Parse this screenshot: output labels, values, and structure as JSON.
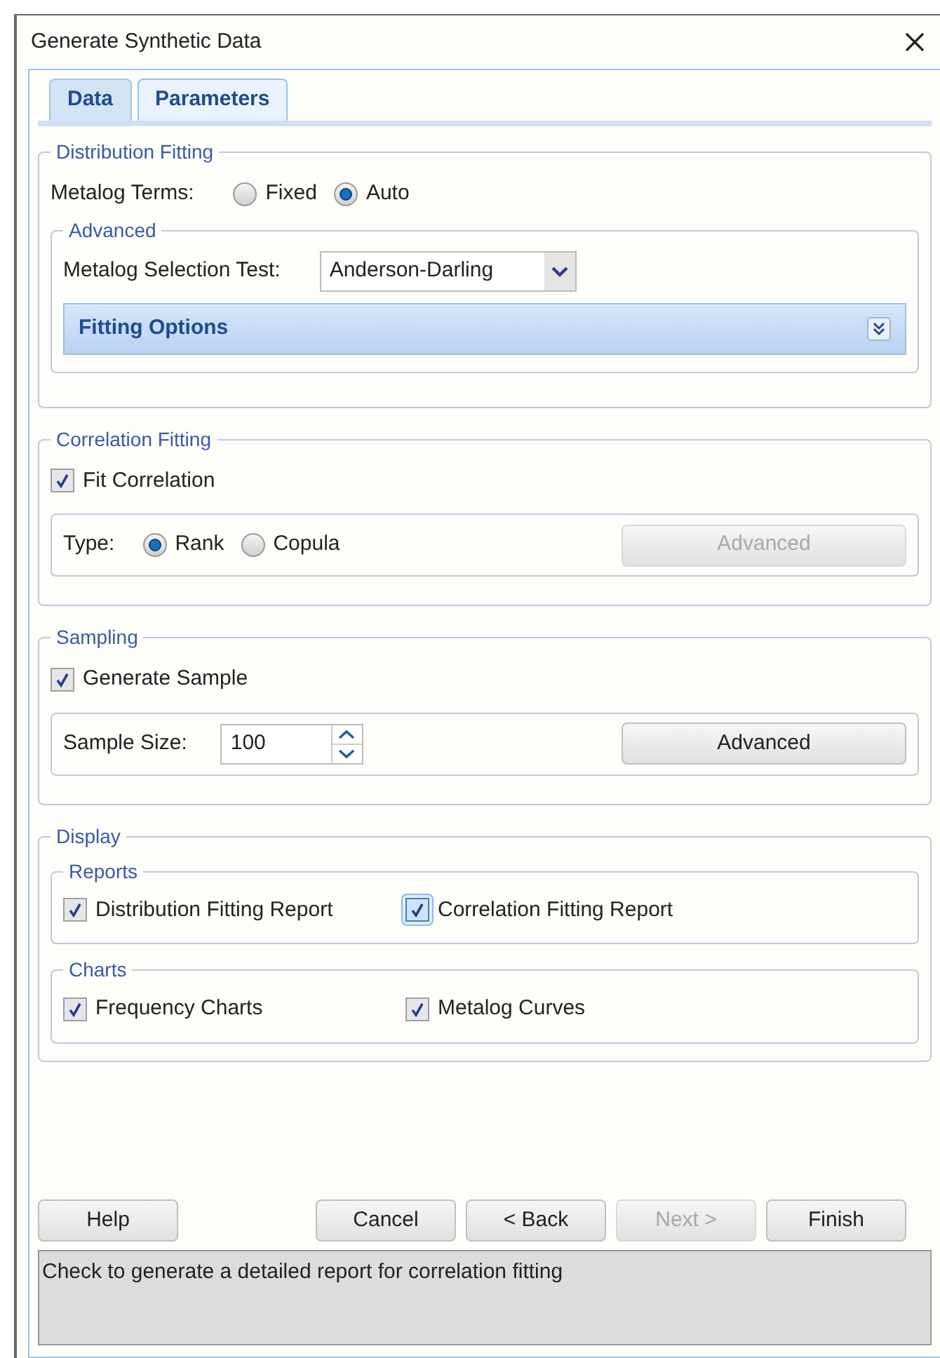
{
  "window": {
    "title": "Generate Synthetic Data"
  },
  "tabs": [
    {
      "label": "Data",
      "selected": false
    },
    {
      "label": "Parameters",
      "selected": true
    }
  ],
  "distribution_fitting": {
    "title": "Distribution Fitting",
    "terms_label": "Metalog Terms:",
    "terms_options": [
      {
        "label": "Fixed",
        "selected": false
      },
      {
        "label": "Auto",
        "selected": true
      }
    ],
    "advanced": {
      "title": "Advanced",
      "test_label": "Metalog Selection Test:",
      "test_value": "Anderson-Darling",
      "fitting_options": {
        "label": "Fitting Options",
        "expanded": false
      }
    }
  },
  "correlation_fitting": {
    "title": "Correlation Fitting",
    "fit": {
      "label": "Fit Correlation",
      "checked": true
    },
    "type_label": "Type:",
    "type_options": [
      {
        "label": "Rank",
        "selected": true
      },
      {
        "label": "Copula",
        "selected": false
      }
    ],
    "advanced_button": {
      "label": "Advanced",
      "disabled": true
    }
  },
  "sampling": {
    "title": "Sampling",
    "generate": {
      "label": "Generate Sample",
      "checked": true
    },
    "size_label": "Sample Size:",
    "size_value": "100",
    "advanced_button": {
      "label": "Advanced",
      "disabled": false
    }
  },
  "display": {
    "title": "Display",
    "groups": [
      {
        "title": "Reports",
        "items": [
          {
            "label": "Distribution Fitting Report",
            "checked": true,
            "focused": false
          },
          {
            "label": "Correlation Fitting Report",
            "checked": true,
            "focused": true
          }
        ]
      },
      {
        "title": "Charts",
        "items": [
          {
            "label": "Frequency Charts",
            "checked": true,
            "focused": false
          },
          {
            "label": "Metalog Curves",
            "checked": true,
            "focused": false
          }
        ]
      }
    ]
  },
  "buttons": [
    {
      "label": "Help",
      "disabled": false
    },
    {
      "label": "Cancel",
      "disabled": false
    },
    {
      "label": "< Back",
      "disabled": false
    },
    {
      "label": "Next >",
      "disabled": true
    },
    {
      "label": "Finish",
      "disabled": false
    }
  ],
  "status": "Check to generate a detailed report for correlation fitting"
}
